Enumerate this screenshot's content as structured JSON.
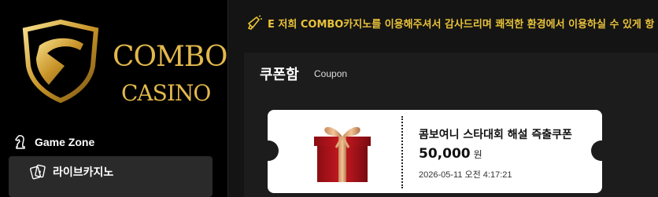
{
  "brand": {
    "line1": "COMBO",
    "line2": "CASINO",
    "gold": "#e2b84c"
  },
  "sidebar": {
    "section_label": "Game Zone",
    "section_icon": "chess-knight-icon",
    "items": [
      {
        "label": "라이브카지노",
        "icon": "playing-cards-icon"
      }
    ]
  },
  "marquee": {
    "icon": "megaphone-icon",
    "text": "E 저희 COMBO카지노를 이용해주셔서 감사드리며 쾌적한 환경에서 이용하실 수 있게 항",
    "color": "#e9c23a"
  },
  "coupon_box": {
    "title": "쿠폰함",
    "subtitle": "Coupon",
    "coupons": [
      {
        "name": "콤보여니 스타대회 해설 즉출쿠폰",
        "amount": "50,000",
        "unit": "원",
        "date": "2026-05-11 오전 4:17:21",
        "icon": "gift-box-icon"
      }
    ]
  }
}
